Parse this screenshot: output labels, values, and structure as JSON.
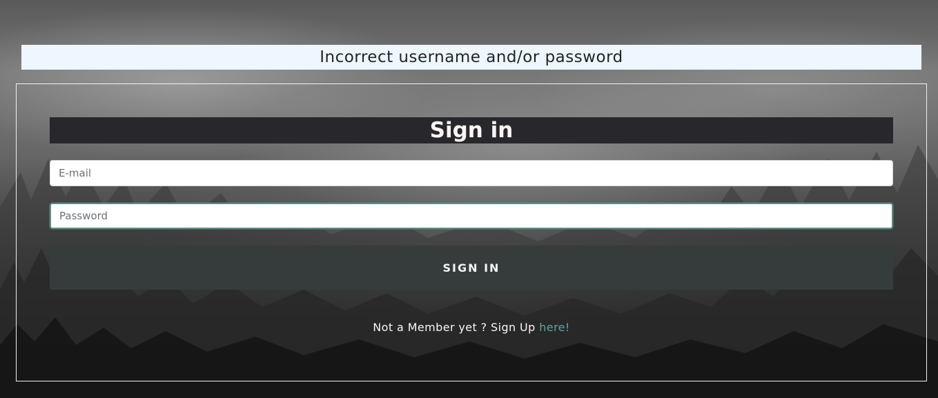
{
  "alert": {
    "message": "Incorrect username and/or password"
  },
  "signin_form": {
    "title": "Sign in",
    "email_placeholder": "E-mail",
    "password_placeholder": "Password",
    "submit_label": "SIGN IN",
    "signup_prompt": "Not a Member yet ? Sign Up",
    "signup_link_label": "here!"
  },
  "colors": {
    "alert_background": "#eef6ff",
    "title_bar": "#28272c",
    "button": "#363c3c",
    "link": "#62a3a0",
    "focus_border": "#5a8f85"
  }
}
